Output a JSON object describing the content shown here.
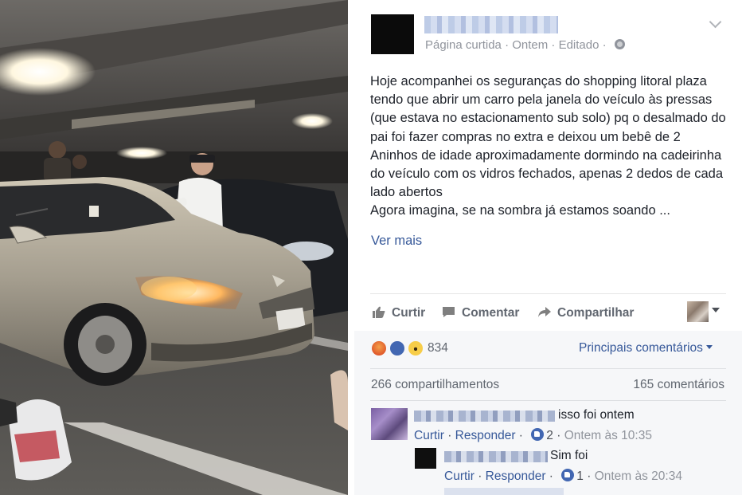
{
  "post": {
    "meta": "Página curtida · Ontem · Editado ·",
    "body": "Hoje acompanhei os seguranças do shopping litoral plaza tendo que abrir um carro pela janela do veículo às pressas (que estava no estacionamento sub solo) pq o desalmado do pai foi fazer compras no extra e deixou um bebê de 2 Aninhos de idade aproximadamente dormindo na cadeirinha do veículo com os vidros fechados, apenas 2 dedos de cada lado abertos\nAgora imagina, se na sombra já estamos soando ...",
    "see_more": "Ver mais"
  },
  "actions": {
    "like": "Curtir",
    "comment": "Comentar",
    "share": "Compartilhar"
  },
  "reactions": {
    "count": "834",
    "sort_label": "Principais comentários",
    "icons": [
      "angry-icon",
      "like-icon",
      "wow-icon"
    ]
  },
  "stats": {
    "shares": "266 compartilhamentos",
    "comments": "165 comentários"
  },
  "comments": [
    {
      "text": "isso foi ontem",
      "like": "Curtir",
      "reply": "Responder",
      "likes": "2",
      "time": "Ontem às 10:35"
    },
    {
      "text": "Sim foi",
      "like": "Curtir",
      "reply": "Responder",
      "likes": "1",
      "time": "Ontem às 20:34"
    }
  ],
  "colors": {
    "link": "#365899",
    "muted": "#90949c",
    "text": "#1d2129",
    "like_blue": "#4267b2"
  }
}
